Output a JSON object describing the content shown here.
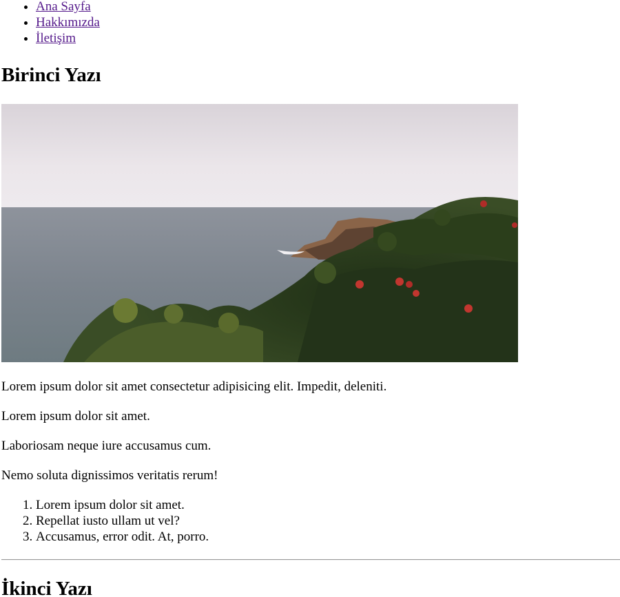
{
  "nav": {
    "items": [
      {
        "label": "Ana Sayfa"
      },
      {
        "label": "Hakkımızda"
      },
      {
        "label": "İletişim"
      }
    ]
  },
  "post1": {
    "title": "Birinci Yazı",
    "paragraphs": [
      "Lorem ipsum dolor sit amet consectetur adipisicing elit. Impedit, deleniti.",
      "Lorem ipsum dolor sit amet.",
      "Laboriosam neque iure accusamus cum.",
      "Nemo soluta dignissimos veritatis rerum!"
    ],
    "list": [
      "Lorem ipsum dolor sit amet.",
      "Repellat iusto ullam ut vel?",
      "Accusamus, error odit. At, porro."
    ]
  },
  "post2": {
    "title": "İkinci Yazı"
  },
  "colors": {
    "link_visited": "#551a8b",
    "text": "#000000",
    "rule": "#9a9a9a"
  }
}
